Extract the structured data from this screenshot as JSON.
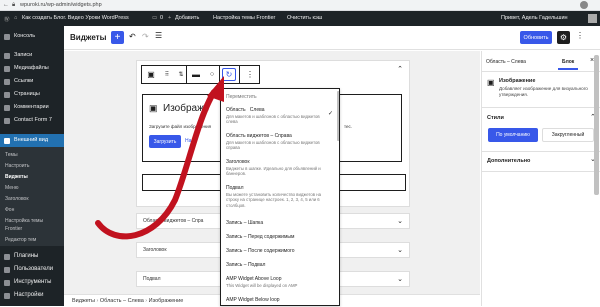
{
  "browser": {
    "url": "wpuroki.ru/wp-admin/widgets.php"
  },
  "adminbar": {
    "site": "Как создать Блог. Видео Уроки WordPress",
    "comments": "0",
    "add": "Добавить",
    "theme": "Настройка темы Frontier",
    "cache": "Очистить кэш",
    "greeting": "Привет, Адель Гадельшин"
  },
  "sidebar": {
    "items": [
      {
        "label": "Консоль"
      },
      {
        "label": "Записи"
      },
      {
        "label": "Медиафайлы"
      },
      {
        "label": "Ссылки"
      },
      {
        "label": "Страницы"
      },
      {
        "label": "Комментарии"
      },
      {
        "label": "Contact Form 7"
      },
      {
        "label": "Внешний вид"
      }
    ],
    "submenu": [
      "Темы",
      "Настроить",
      "Виджеты",
      "Меню",
      "Заголовок",
      "Фон",
      "Настройка темы",
      "Frontier",
      "Редактор тем"
    ],
    "bottom": [
      {
        "label": "Плагины"
      },
      {
        "label": "Пользователи"
      },
      {
        "label": "Инструменты"
      },
      {
        "label": "Настройки"
      }
    ]
  },
  "topbar": {
    "title": "Виджеты",
    "update": "Обновить"
  },
  "image_block": {
    "title": "Изображе",
    "desc": "Загрузите файл изображения",
    "desc_tail": "тес.",
    "upload": "Загрузить",
    "upload_tail": "На"
  },
  "dropdown": {
    "heading": "Переместить",
    "items": [
      {
        "label": "Область &nbsp; Слева",
        "desc": "Для макетов и шаблонов с областью виджетов слева",
        "checked": true
      },
      {
        "label": "Область виджетов &ndash; Справа",
        "desc": "Для макетов и шаблонов с областью виджетов справа"
      },
      {
        "label": "Заголовок",
        "desc": "Виджеты в шапке. Идеально для объявлений и баннеров."
      },
      {
        "label": "Подвал",
        "desc": "Вы можете установить количество виджетов на строку на странице настроек. 1, 2, 3, 4, 5 или 6 столбцов."
      },
      {
        "label": "Запись &ndash; Шапка"
      },
      {
        "label": "Запись &ndash; Перед содержимым"
      },
      {
        "label": "Запись &ndash; После содержимого"
      },
      {
        "label": "Запись &ndash; Подвал"
      },
      {
        "label": "AMP Widget Above Loop",
        "desc": "This Widget will be displayed on AMP"
      },
      {
        "label": "AMP Widget Below loop"
      }
    ]
  },
  "areas": [
    {
      "label": "Область виджетов &ndash; Спра"
    },
    {
      "label": "Заголовок"
    },
    {
      "label": "Подвал"
    }
  ],
  "settings": {
    "tab1": "Область &ndash; Слева",
    "tab2": "Блок",
    "block_title": "Изображение",
    "block_desc": "Добавляет изображение для визуального утверждения.",
    "style_heading": "Стили",
    "style1": "По умолчанию",
    "style2": "Закругленный",
    "advanced": "Дополнительно"
  },
  "breadcrumb": [
    "Виджеты",
    "Область – Слева",
    "Изображение"
  ]
}
